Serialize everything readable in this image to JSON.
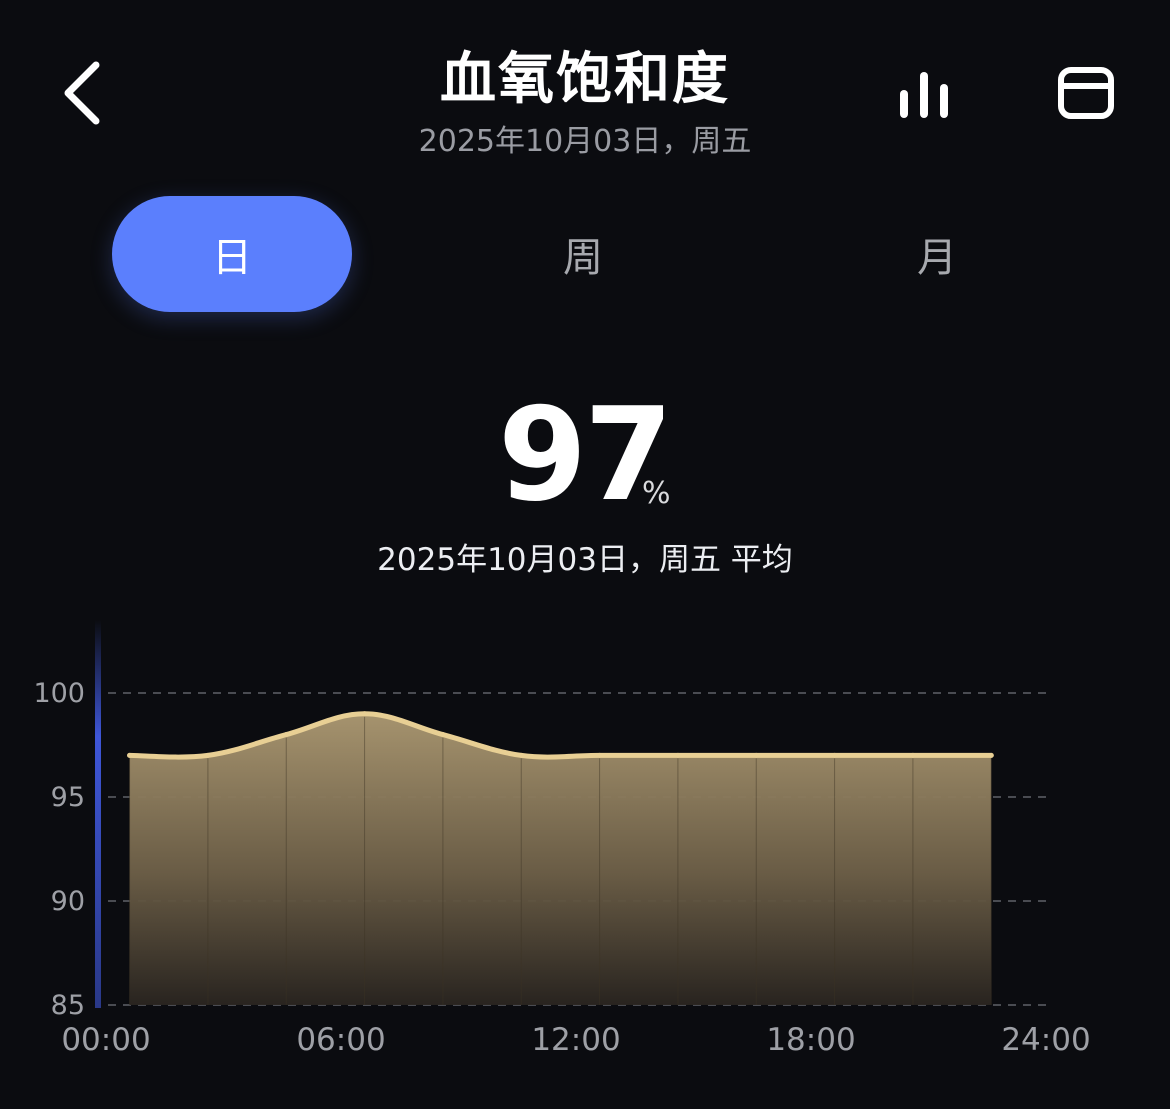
{
  "header": {
    "title": "血氧饱和度",
    "subtitle": "2025年10月03日，周五",
    "back_icon": "chevron-left-icon",
    "stats_icon": "bar-chart-icon",
    "calendar_icon": "card-icon"
  },
  "tabs": [
    {
      "label": "日",
      "active": true
    },
    {
      "label": "周",
      "active": false
    },
    {
      "label": "月",
      "active": false
    }
  ],
  "summary": {
    "value": "97",
    "unit": "%",
    "label": "2025年10月03日，周五 平均"
  },
  "colors": {
    "accent": "#5b7ffd",
    "line": "#e8cf94",
    "fill_top": "#a99670",
    "background": "#0b0c10"
  },
  "chart_data": {
    "type": "area",
    "x_label_ticks": [
      "00:00",
      "06:00",
      "12:00",
      "18:00",
      "24:00"
    ],
    "y_ticks": [
      100,
      95,
      90,
      85
    ],
    "ylim": [
      85,
      100
    ],
    "xlim": [
      0,
      24
    ],
    "x": [
      0.5,
      2.5,
      4.5,
      6.5,
      8.5,
      10.5,
      12.5,
      14.5,
      16.5,
      18.5,
      20.5,
      22.5
    ],
    "values": [
      97,
      97,
      98,
      99,
      98,
      97,
      97,
      97,
      97,
      97,
      97,
      97
    ],
    "grid": true,
    "xlabel": "",
    "ylabel": ""
  }
}
